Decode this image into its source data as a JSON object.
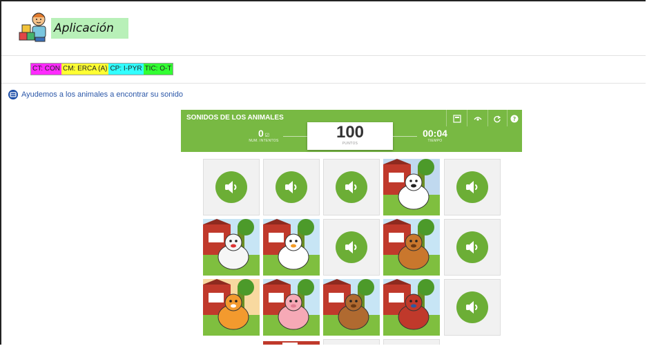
{
  "header": {
    "title": "Aplicación"
  },
  "tags": [
    {
      "label": "CT: CON",
      "color": "#ff2bff"
    },
    {
      "label": "CM: ERCA (A)",
      "color": "#ffff33"
    },
    {
      "label": "CP: I-PYR",
      "color": "#33ffff"
    },
    {
      "label": "TIC: O-T",
      "color": "#33ff33"
    }
  ],
  "activity": {
    "link_text": "Ayudemos a los animales a encontrar su sonido"
  },
  "game": {
    "title": "SONIDOS DE LOS ANIMALES",
    "attempts_value": "0",
    "attempts_label": "NUM. INTENTOS",
    "points_value": "100",
    "points_label": "PUNTOS",
    "time_value": "00:04",
    "time_label": "TIEMPO",
    "accent_color": "#78b943",
    "controls": [
      "fullscreen-icon",
      "eye-icon",
      "restart-icon",
      "help-icon"
    ]
  },
  "cards": [
    {
      "type": "sound"
    },
    {
      "type": "sound"
    },
    {
      "type": "sound"
    },
    {
      "type": "image",
      "animal": "cow"
    },
    {
      "type": "sound"
    },
    {
      "type": "image",
      "animal": "hen"
    },
    {
      "type": "image",
      "animal": "duck"
    },
    {
      "type": "sound"
    },
    {
      "type": "image",
      "animal": "horse"
    },
    {
      "type": "sound"
    },
    {
      "type": "image",
      "animal": "cat"
    },
    {
      "type": "image",
      "animal": "pig"
    },
    {
      "type": "image",
      "animal": "dog"
    },
    {
      "type": "image",
      "animal": "rooster"
    },
    {
      "type": "sound"
    }
  ]
}
